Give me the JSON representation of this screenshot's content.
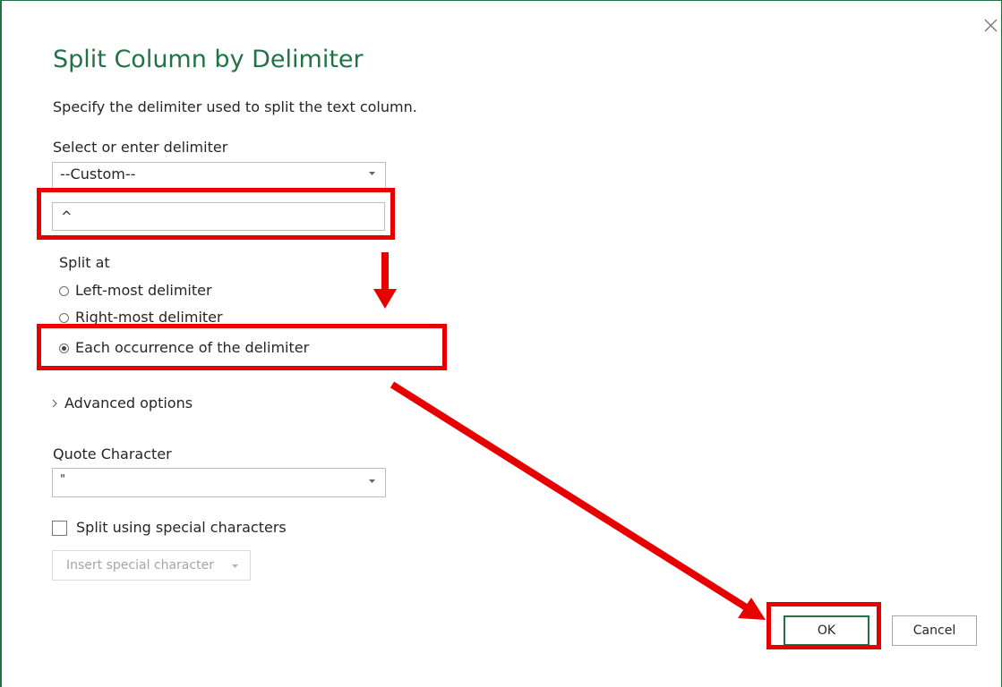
{
  "dialog": {
    "title": "Split Column by Delimiter",
    "subtitle": "Specify the delimiter used to split the text column.",
    "accent_color": "#217346",
    "close_icon": "close-icon"
  },
  "delimiter": {
    "label": "Select or enter delimiter",
    "selected": "--Custom--",
    "custom_value": "^"
  },
  "split_at": {
    "label": "Split at",
    "options": [
      {
        "label": "Left-most delimiter",
        "checked": false
      },
      {
        "label": "Right-most delimiter",
        "checked": false
      },
      {
        "label": "Each occurrence of the delimiter",
        "checked": true
      }
    ]
  },
  "advanced": {
    "label": "Advanced options",
    "icon": "chevron-right-icon"
  },
  "quote": {
    "label": "Quote Character",
    "selected": "\""
  },
  "special": {
    "checkbox_label": "Split using special characters",
    "checked": false,
    "insert_label": "Insert special character"
  },
  "buttons": {
    "ok": "OK",
    "cancel": "Cancel"
  },
  "annotation": {
    "color": "#e60000"
  }
}
